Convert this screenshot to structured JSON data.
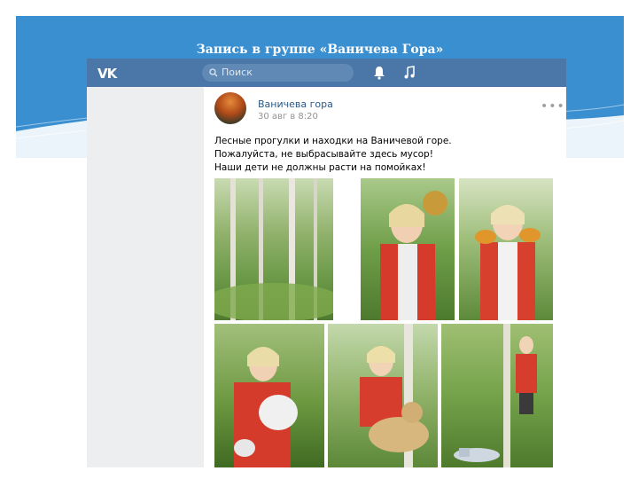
{
  "slide": {
    "title": "Запись в группе «Ваничева Гора»"
  },
  "topbar": {
    "logo": "VK",
    "search_placeholder": "Поиск",
    "icons": [
      "bell-icon",
      "music-icon"
    ]
  },
  "post": {
    "group_name": "Ваничева гора",
    "date": "30 авг в 8:20",
    "more": "•••",
    "text_lines": [
      "Лесные прогулки и находки на Ваничевой горе.",
      "Пожалуйста, не выбрасывайте здесь мусор!",
      "Наши дети не должны расти на помойках!"
    ],
    "photos": 6
  },
  "colors": {
    "vk_blue": "#4a76a8",
    "link": "#2a5885",
    "slide_blue": "#3a8fd0"
  }
}
